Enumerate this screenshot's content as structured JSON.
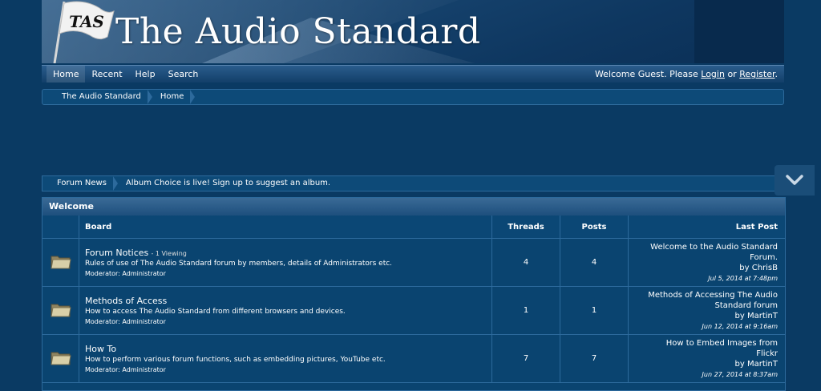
{
  "site": {
    "title": "The Audio Standard",
    "flag_text": "TAS",
    "colors": {
      "background": "#0a3a63",
      "border": "#2d6a9c",
      "navbar": "#1d4f7d"
    }
  },
  "nav": {
    "tabs": [
      "Home",
      "Recent",
      "Help",
      "Search"
    ],
    "welcome_prefix": "Welcome Guest. Please",
    "login_label": "Login",
    "or_text": "or",
    "register_label": "Register",
    "period": "."
  },
  "breadcrumb": [
    "The Audio Standard",
    "Home"
  ],
  "news": {
    "label": "Forum News",
    "text": "Album Choice is live! Sign up to suggest an album."
  },
  "forum": {
    "section_title": "Welcome",
    "columns": {
      "board": "Board",
      "threads": "Threads",
      "posts": "Posts",
      "last_post": "Last Post"
    },
    "boards": [
      {
        "name": "Forum Notices",
        "viewing": "- 1 Viewing",
        "description": "Rules of use of The Audio Standard forum by members, details of Administrators etc.",
        "moderator": "Moderator: Administrator",
        "threads": "4",
        "posts": "4",
        "last_title_1": "Welcome to the Audio Standard",
        "last_title_2": "Forum.",
        "last_by": "by ChrisB",
        "last_date": "Jul 5, 2014 at 7:48pm"
      },
      {
        "name": "Methods of Access",
        "viewing": "",
        "description": "How to access The Audio Standard from different browsers and devices.",
        "moderator": "Moderator: Administrator",
        "threads": "1",
        "posts": "1",
        "last_title_1": "Methods of Accessing The Audio",
        "last_title_2": "Standard forum",
        "last_by": "by MartinT",
        "last_date": "Jun 12, 2014 at 9:16am"
      },
      {
        "name": "How To",
        "viewing": "",
        "description": "How to perform various forum functions, such as embedding pictures, YouTube etc.",
        "moderator": "Moderator: Administrator",
        "threads": "7",
        "posts": "7",
        "last_title_1": "How to Embed Images from",
        "last_title_2": "Flickr",
        "last_by": "by MartinT",
        "last_date": "Jun 27, 2014 at 8:37am"
      }
    ]
  },
  "icons": {
    "folder": "folder-icon",
    "flag": "flag-icon",
    "collapse": "chevron-down-icon"
  }
}
